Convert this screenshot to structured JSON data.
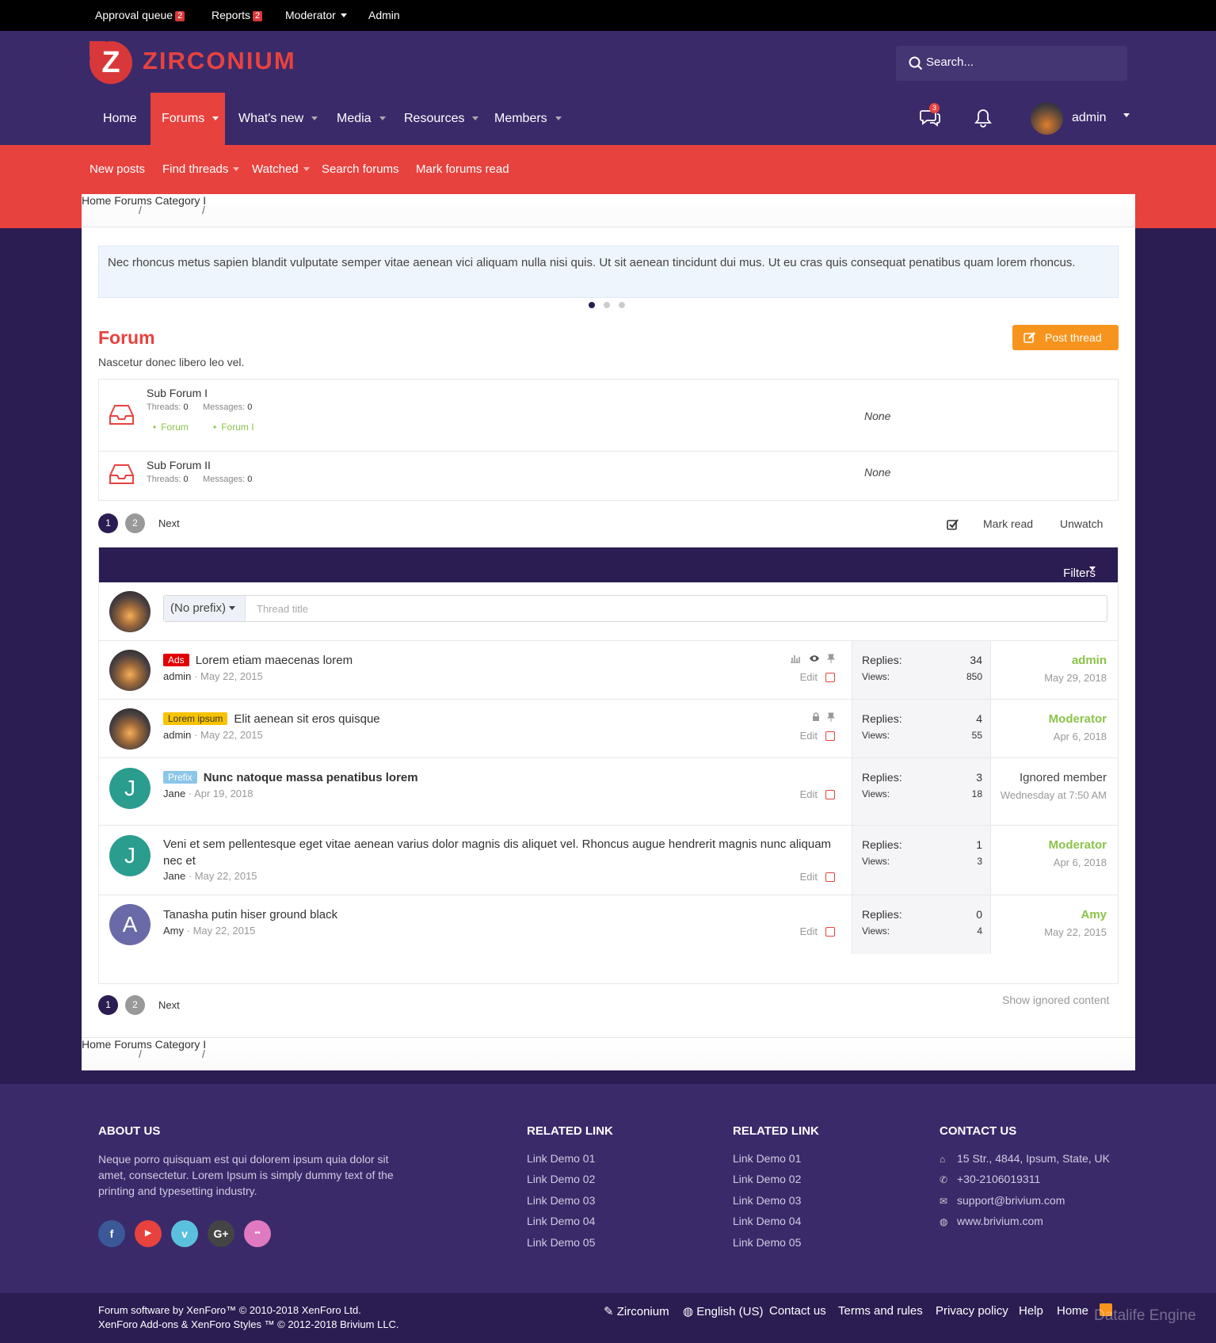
{
  "staff_bar": {
    "approval_queue": "Approval queue",
    "approval_count": "2",
    "reports": "Reports",
    "reports_count": "2",
    "moderator": "Moderator",
    "admin": "Admin"
  },
  "header": {
    "logo_letter": "Z",
    "logo_text": "ZIRCONIUM",
    "search_placeholder": "Search..."
  },
  "nav": {
    "tabs": [
      {
        "label": "Home"
      },
      {
        "label": "Forums"
      },
      {
        "label": "What's new"
      },
      {
        "label": "Media"
      },
      {
        "label": "Resources"
      },
      {
        "label": "Members"
      }
    ],
    "conversations_count": "3",
    "username": "admin"
  },
  "subnav": {
    "new_posts": "New posts",
    "find_threads": "Find threads",
    "watched": "Watched",
    "search_forums": "Search forums",
    "mark_read": "Mark forums read"
  },
  "breadcrumb": {
    "home": "Home",
    "forums": "Forums",
    "category": "Category I",
    "sep": "/"
  },
  "notice": {
    "text": "Nec rhoncus metus sapien blandit vulputate semper vitae aenean vici aliquam nulla nisi quis. Ut sit aenean tincidunt dui mus. Ut eu cras quis consequat penatibus quam lorem rhoncus."
  },
  "forum": {
    "title": "Forum",
    "description": "Nascetur donec libero leo vel.",
    "post_thread": "Post thread"
  },
  "subforums": [
    {
      "name": "Sub Forum I",
      "threads_label": "Threads:",
      "threads": "0",
      "messages_label": "Messages:",
      "messages": "0",
      "children": [
        "Forum",
        "Forum I"
      ],
      "last": "None"
    },
    {
      "name": "Sub Forum II",
      "threads_label": "Threads:",
      "threads": "0",
      "messages_label": "Messages:",
      "messages": "0",
      "last": "None"
    }
  ],
  "pager": {
    "pages": [
      "1",
      "2"
    ],
    "next": "Next"
  },
  "list_actions": {
    "mark_read": "Mark read",
    "unwatch": "Unwatch"
  },
  "filters": {
    "label": "Filters"
  },
  "quick_thread": {
    "prefix": "(No prefix)",
    "placeholder": "Thread title"
  },
  "threads": [
    {
      "label": "Ads",
      "title": "Lorem etiam maecenas lorem",
      "author": "admin",
      "date": "May 22, 2015",
      "edit": "Edit",
      "replies_label": "Replies:",
      "replies": "34",
      "views_label": "Views:",
      "views": "850",
      "last_user": "admin",
      "last_date": "May 29, 2018"
    },
    {
      "label": "Lorem ipsum",
      "title": "Elit aenean sit eros quisque",
      "author": "admin",
      "date": "May 22, 2015",
      "edit": "Edit",
      "replies_label": "Replies:",
      "replies": "4",
      "views_label": "Views:",
      "views": "55",
      "last_user": "Moderator",
      "last_date": "Apr 6, 2018"
    },
    {
      "label": "Prefix",
      "title": "Nunc natoque massa penatibus lorem",
      "author": "Jane",
      "date": "Apr 19, 2018",
      "edit": "Edit",
      "replies_label": "Replies:",
      "replies": "3",
      "views_label": "Views:",
      "views": "18",
      "last_user": "Ignored member",
      "last_date": "Wednesday at 7:50 AM",
      "avatar_letter": "J"
    },
    {
      "title": "Veni et sem pellentesque eget vitae aenean varius dolor magnis dis aliquet vel. Rhoncus augue hendrerit magnis nunc aliquam nec et",
      "author": "Jane",
      "date": "May 22, 2015",
      "edit": "Edit",
      "replies_label": "Replies:",
      "replies": "1",
      "views_label": "Views:",
      "views": "3",
      "last_user": "Moderator",
      "last_date": "Apr 6, 2018",
      "avatar_letter": "J"
    },
    {
      "title": "Tanasha putin hiser ground black",
      "author": "Amy",
      "date": "May 22, 2015",
      "edit": "Edit",
      "replies_label": "Replies:",
      "replies": "0",
      "views_label": "Views:",
      "views": "4",
      "last_user": "Amy",
      "last_date": "May 22, 2015",
      "avatar_letter": "A"
    }
  ],
  "show_ignored": "Show ignored content",
  "footer": {
    "about_title": "ABOUT US",
    "about_text": "Neque porro quisquam est qui dolorem ipsum quia dolor sit amet, consectetur. Lorem Ipsum is simply dummy text of the printing and typesetting industry.",
    "social": [
      "f",
      "▶",
      "v",
      "G+",
      "••"
    ],
    "related_title_1": "RELATED LINK",
    "related_title_2": "RELATED LINK",
    "links": [
      "Link Demo 01",
      "Link Demo 02",
      "Link Demo 03",
      "Link Demo 04",
      "Link Demo 05"
    ],
    "contact_title": "CONTACT US",
    "address": "15 Str., 4844, Ipsum, State, UK",
    "phone": "+30-2106019311",
    "email": "support@brivium.com",
    "website": "www.brivium.com"
  },
  "copyright": {
    "line1": "Forum software by XenForo™ © 2010-2018 XenForo Ltd.",
    "line2": "XenForo Add-ons & XenForo Styles ™ © 2012-2018 Brivium LLC.",
    "style": "Zirconium",
    "language": "English (US)",
    "contact": "Contact us",
    "terms": "Terms and rules",
    "privacy": "Privacy policy",
    "help": "Help",
    "home": "Home",
    "watermark": "Datalife Engine"
  },
  "colors": {
    "accent": "#e8423e",
    "primary": "#3a2a6a",
    "dark": "#2b1d52",
    "button": "#f7941d",
    "green": "#8bc34a"
  }
}
